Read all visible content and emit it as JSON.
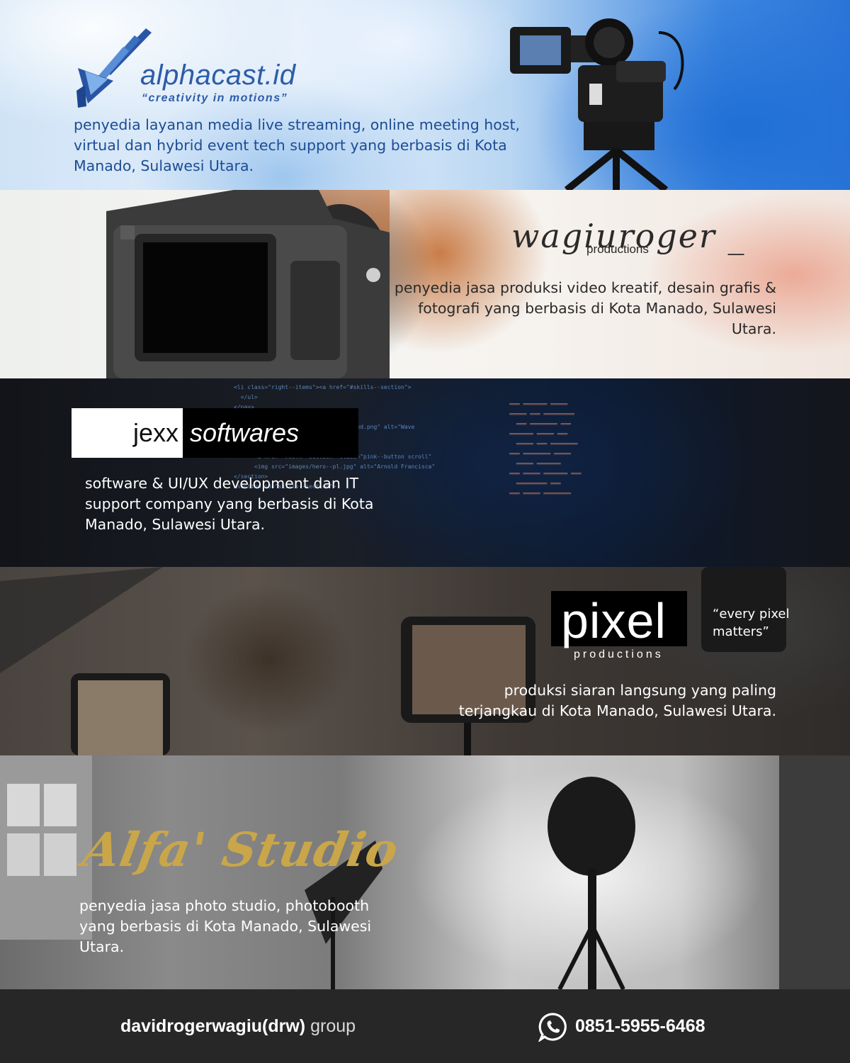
{
  "sections": {
    "alphacast": {
      "logo_text": "alphacast.id",
      "tagline": "“creativity in motions”",
      "description": "penyedia layanan media live streaming, online meeting host, virtual dan hybrid event tech support yang berbasis di Kota Manado, Sulawesi Utara."
    },
    "wagiuroger": {
      "logo_text": "wagiuroger _",
      "logo_sub": "productions",
      "description": "penyedia jasa produksi video kreatif, desain grafis & fotografi yang berbasis di Kota Manado, Sulawesi Utara."
    },
    "jexx": {
      "logo_part1": "jexx",
      "logo_part2": "softwares",
      "description": "software & UI/UX development dan IT support company yang berbasis di Kota Manado, Sulawesi Utara."
    },
    "pixel": {
      "logo_text": "pixel",
      "logo_sub": "productions",
      "quote": "“every pixel matters”",
      "description": "produksi siaran langsung yang paling terjangkau di Kota Manado, Sulawesi Utara."
    },
    "alfa": {
      "logo_text": "Alfa' Studio",
      "description": "penyedia jasa photo studio, photobooth yang berbasis di Kota Manado, Sulawesi Utara."
    }
  },
  "footer": {
    "brand_bold": "davidrogerwagiu(drw)",
    "brand_light": "group",
    "phone": "0851-5955-6468",
    "phone_icon": "whatsapp-icon"
  },
  "colors": {
    "alphacast_blue": "#2d5ca8",
    "alfa_gold": "#c9a64a",
    "footer_bg": "#272727"
  }
}
